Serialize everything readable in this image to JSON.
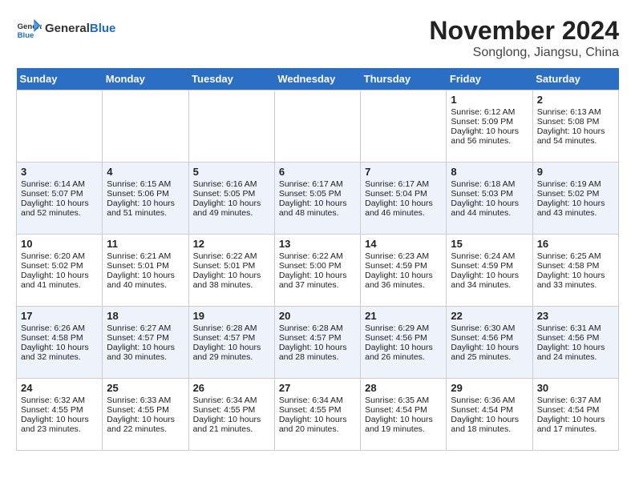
{
  "header": {
    "logo_general": "General",
    "logo_blue": "Blue",
    "month_year": "November 2024",
    "location": "Songlong, Jiangsu, China"
  },
  "weekdays": [
    "Sunday",
    "Monday",
    "Tuesday",
    "Wednesday",
    "Thursday",
    "Friday",
    "Saturday"
  ],
  "weeks": [
    [
      {
        "day": "",
        "content": ""
      },
      {
        "day": "",
        "content": ""
      },
      {
        "day": "",
        "content": ""
      },
      {
        "day": "",
        "content": ""
      },
      {
        "day": "",
        "content": ""
      },
      {
        "day": "1",
        "content": "Sunrise: 6:12 AM\nSunset: 5:09 PM\nDaylight: 10 hours and 56 minutes."
      },
      {
        "day": "2",
        "content": "Sunrise: 6:13 AM\nSunset: 5:08 PM\nDaylight: 10 hours and 54 minutes."
      }
    ],
    [
      {
        "day": "3",
        "content": "Sunrise: 6:14 AM\nSunset: 5:07 PM\nDaylight: 10 hours and 52 minutes."
      },
      {
        "day": "4",
        "content": "Sunrise: 6:15 AM\nSunset: 5:06 PM\nDaylight: 10 hours and 51 minutes."
      },
      {
        "day": "5",
        "content": "Sunrise: 6:16 AM\nSunset: 5:05 PM\nDaylight: 10 hours and 49 minutes."
      },
      {
        "day": "6",
        "content": "Sunrise: 6:17 AM\nSunset: 5:05 PM\nDaylight: 10 hours and 48 minutes."
      },
      {
        "day": "7",
        "content": "Sunrise: 6:17 AM\nSunset: 5:04 PM\nDaylight: 10 hours and 46 minutes."
      },
      {
        "day": "8",
        "content": "Sunrise: 6:18 AM\nSunset: 5:03 PM\nDaylight: 10 hours and 44 minutes."
      },
      {
        "day": "9",
        "content": "Sunrise: 6:19 AM\nSunset: 5:02 PM\nDaylight: 10 hours and 43 minutes."
      }
    ],
    [
      {
        "day": "10",
        "content": "Sunrise: 6:20 AM\nSunset: 5:02 PM\nDaylight: 10 hours and 41 minutes."
      },
      {
        "day": "11",
        "content": "Sunrise: 6:21 AM\nSunset: 5:01 PM\nDaylight: 10 hours and 40 minutes."
      },
      {
        "day": "12",
        "content": "Sunrise: 6:22 AM\nSunset: 5:01 PM\nDaylight: 10 hours and 38 minutes."
      },
      {
        "day": "13",
        "content": "Sunrise: 6:22 AM\nSunset: 5:00 PM\nDaylight: 10 hours and 37 minutes."
      },
      {
        "day": "14",
        "content": "Sunrise: 6:23 AM\nSunset: 4:59 PM\nDaylight: 10 hours and 36 minutes."
      },
      {
        "day": "15",
        "content": "Sunrise: 6:24 AM\nSunset: 4:59 PM\nDaylight: 10 hours and 34 minutes."
      },
      {
        "day": "16",
        "content": "Sunrise: 6:25 AM\nSunset: 4:58 PM\nDaylight: 10 hours and 33 minutes."
      }
    ],
    [
      {
        "day": "17",
        "content": "Sunrise: 6:26 AM\nSunset: 4:58 PM\nDaylight: 10 hours and 32 minutes."
      },
      {
        "day": "18",
        "content": "Sunrise: 6:27 AM\nSunset: 4:57 PM\nDaylight: 10 hours and 30 minutes."
      },
      {
        "day": "19",
        "content": "Sunrise: 6:28 AM\nSunset: 4:57 PM\nDaylight: 10 hours and 29 minutes."
      },
      {
        "day": "20",
        "content": "Sunrise: 6:28 AM\nSunset: 4:57 PM\nDaylight: 10 hours and 28 minutes."
      },
      {
        "day": "21",
        "content": "Sunrise: 6:29 AM\nSunset: 4:56 PM\nDaylight: 10 hours and 26 minutes."
      },
      {
        "day": "22",
        "content": "Sunrise: 6:30 AM\nSunset: 4:56 PM\nDaylight: 10 hours and 25 minutes."
      },
      {
        "day": "23",
        "content": "Sunrise: 6:31 AM\nSunset: 4:56 PM\nDaylight: 10 hours and 24 minutes."
      }
    ],
    [
      {
        "day": "24",
        "content": "Sunrise: 6:32 AM\nSunset: 4:55 PM\nDaylight: 10 hours and 23 minutes."
      },
      {
        "day": "25",
        "content": "Sunrise: 6:33 AM\nSunset: 4:55 PM\nDaylight: 10 hours and 22 minutes."
      },
      {
        "day": "26",
        "content": "Sunrise: 6:34 AM\nSunset: 4:55 PM\nDaylight: 10 hours and 21 minutes."
      },
      {
        "day": "27",
        "content": "Sunrise: 6:34 AM\nSunset: 4:55 PM\nDaylight: 10 hours and 20 minutes."
      },
      {
        "day": "28",
        "content": "Sunrise: 6:35 AM\nSunset: 4:54 PM\nDaylight: 10 hours and 19 minutes."
      },
      {
        "day": "29",
        "content": "Sunrise: 6:36 AM\nSunset: 4:54 PM\nDaylight: 10 hours and 18 minutes."
      },
      {
        "day": "30",
        "content": "Sunrise: 6:37 AM\nSunset: 4:54 PM\nDaylight: 10 hours and 17 minutes."
      }
    ]
  ]
}
